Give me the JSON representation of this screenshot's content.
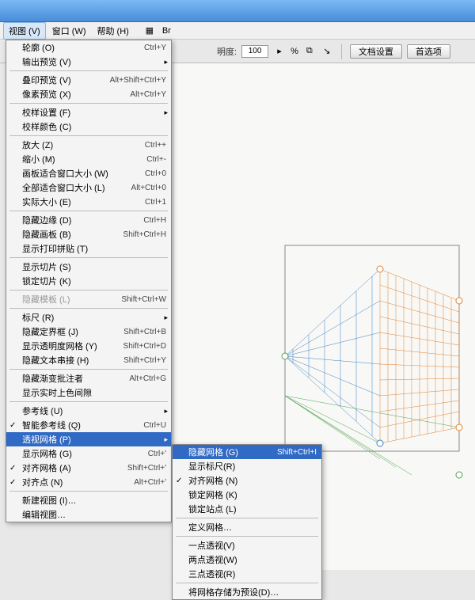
{
  "menubar": {
    "view": "视图 (V)",
    "window": "窗口 (W)",
    "help": "帮助 (H)",
    "br": "Br"
  },
  "toolbar": {
    "opacity_label": "明度:",
    "opacity_value": "100",
    "percent": "%",
    "doc_setup": "文档设置",
    "preferences": "首选项"
  },
  "view_menu": {
    "outline": "轮廓 (O)",
    "outline_sc": "Ctrl+Y",
    "output_preview": "输出预览 (V)",
    "overprint": "叠印预览 (V)",
    "overprint_sc": "Alt+Shift+Ctrl+Y",
    "pixel_preview": "像素预览 (X)",
    "pixel_preview_sc": "Alt+Ctrl+Y",
    "proof_setup": "校样设置 (F)",
    "proof_colors": "校样颜色 (C)",
    "zoom_in": "放大 (Z)",
    "zoom_in_sc": "Ctrl++",
    "zoom_out": "缩小 (M)",
    "zoom_out_sc": "Ctrl+-",
    "fit_artboard": "画板适合窗口大小 (W)",
    "fit_artboard_sc": "Ctrl+0",
    "fit_all": "全部适合窗口大小 (L)",
    "fit_all_sc": "Alt+Ctrl+0",
    "actual_size": "实际大小 (E)",
    "actual_size_sc": "Ctrl+1",
    "hide_edges": "隐藏边缘 (D)",
    "hide_edges_sc": "Ctrl+H",
    "hide_artboards": "隐藏画板 (B)",
    "hide_artboards_sc": "Shift+Ctrl+H",
    "show_print_tiling": "显示打印拼贴 (T)",
    "show_slices": "显示切片 (S)",
    "lock_slices": "锁定切片 (K)",
    "hide_template": "隐藏模板 (L)",
    "hide_template_sc": "Shift+Ctrl+W",
    "rulers": "标尺 (R)",
    "hide_bbox": "隐藏定界框 (J)",
    "hide_bbox_sc": "Shift+Ctrl+B",
    "show_transp": "显示透明度网格 (Y)",
    "show_transp_sc": "Shift+Ctrl+D",
    "hide_text_threads": "隐藏文本串接 (H)",
    "hide_text_threads_sc": "Shift+Ctrl+Y",
    "hide_gradient": "隐藏渐变批注者",
    "hide_gradient_sc": "Alt+Ctrl+G",
    "live_paint_gaps": "显示实时上色间隙",
    "guides": "参考线 (U)",
    "smart_guides": "智能参考线 (Q)",
    "smart_guides_sc": "Ctrl+U",
    "perspective_grid": "透视网格 (P)",
    "show_grid": "显示网格 (G)",
    "show_grid_sc": "Ctrl+'",
    "snap_grid": "对齐网格 (A)",
    "snap_grid_sc": "Shift+Ctrl+'",
    "snap_point": "对齐点 (N)",
    "snap_point_sc": "Alt+Ctrl+'",
    "new_view": "新建视图 (I)…",
    "edit_views": "编辑视图…"
  },
  "sub": {
    "hide_grid": "隐藏网格 (G)",
    "hide_grid_sc": "Shift+Ctrl+I",
    "show_rulers": "显示标尺(R)",
    "snap_grid": "对齐网格 (N)",
    "lock_grid": "锁定网格 (K)",
    "lock_station": "锁定站点 (L)",
    "define_grid": "定义网格…",
    "one_point": "一点透视(V)",
    "two_point": "两点透视(W)",
    "three_point": "三点透视(R)",
    "save_as_preset": "将网格存储为预设(D)…"
  }
}
